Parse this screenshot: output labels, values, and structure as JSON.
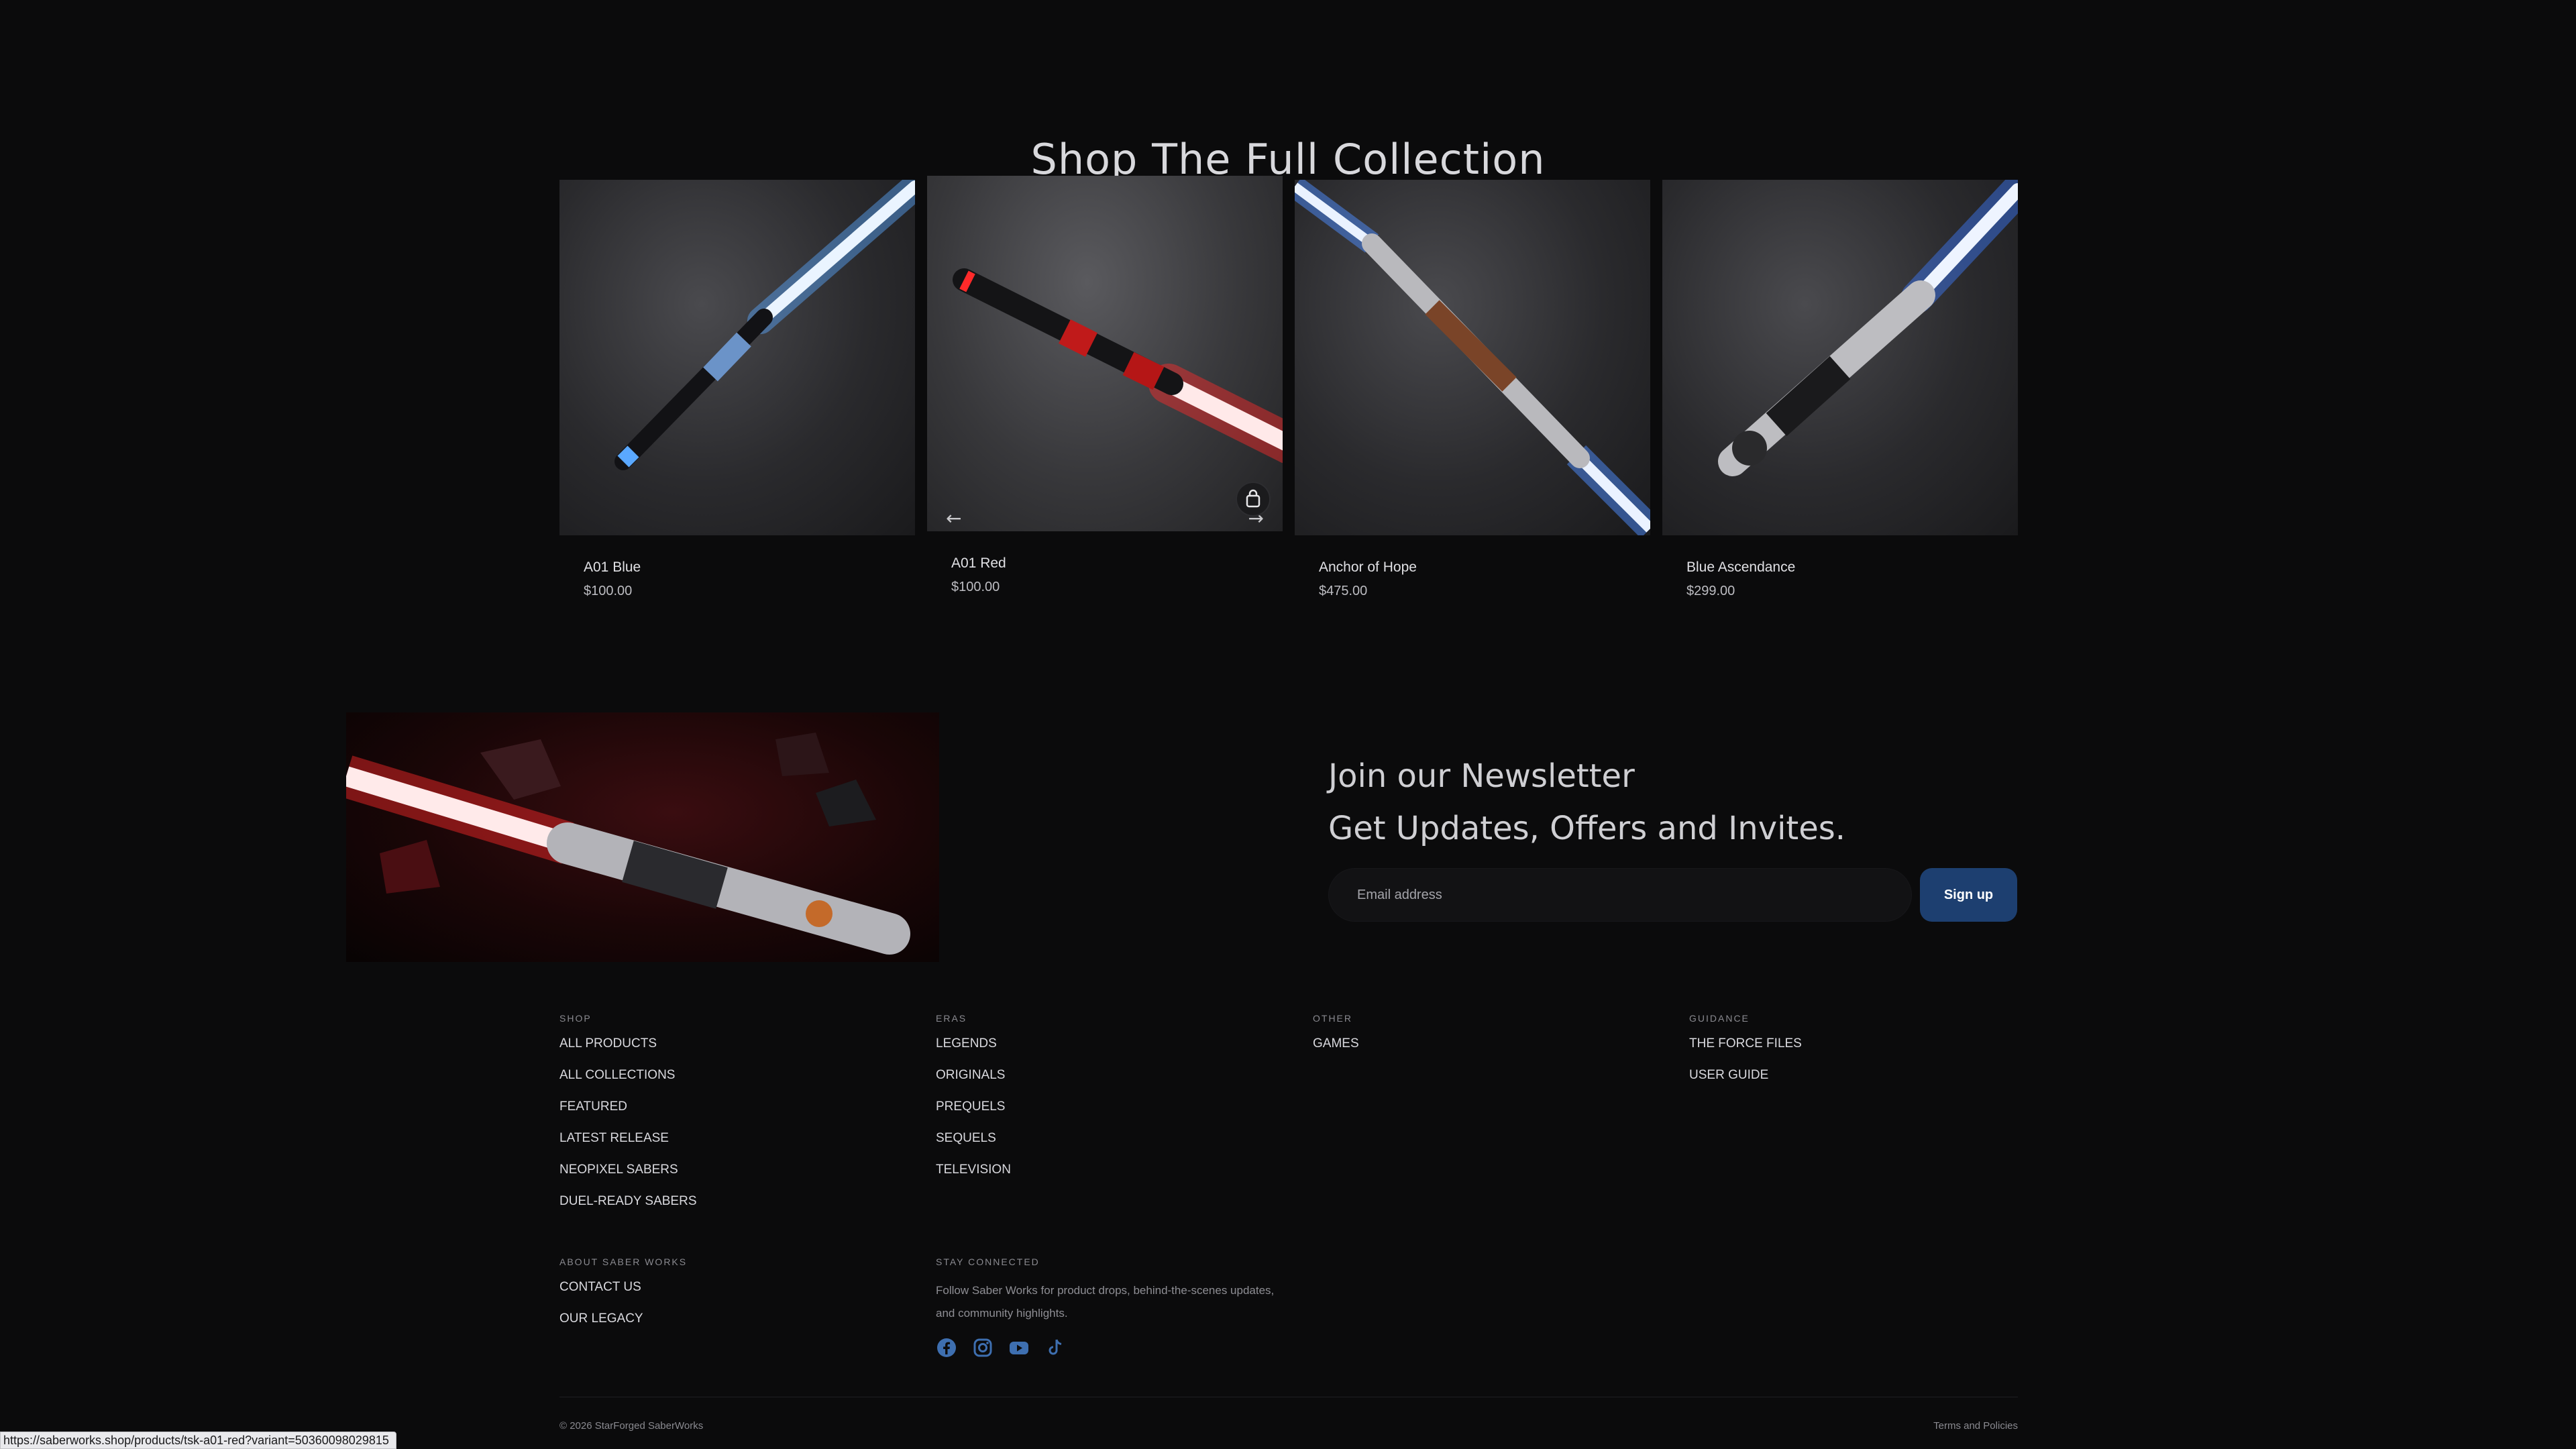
{
  "collection": {
    "title": "Shop The Full Collection",
    "products": [
      {
        "name": "A01 Blue",
        "price": "$100.00",
        "blade_color": "#5aa8ff"
      },
      {
        "name": "A01 Red",
        "price": "$100.00",
        "blade_color": "#ff2a2a"
      },
      {
        "name": "Anchor of Hope",
        "price": "$475.00",
        "blade_color": "#4d8dff"
      },
      {
        "name": "Blue Ascendance",
        "price": "$299.00",
        "blade_color": "#3d7bff"
      }
    ],
    "carousel_prev": "←",
    "carousel_next": "→"
  },
  "newsletter": {
    "line1": "Join our Newsletter",
    "line2": "Get Updates, Offers and Invites.",
    "email_placeholder": "Email address",
    "signup_label": "Sign up",
    "accent": "#1d3f70"
  },
  "footer": {
    "shop": {
      "heading": "SHOP",
      "items": [
        "ALL PRODUCTS",
        "ALL COLLECTIONS",
        "FEATURED",
        "LATEST RELEASE",
        "NEOPIXEL SABERS",
        "DUEL-READY SABERS"
      ]
    },
    "eras": {
      "heading": "ERAS",
      "items": [
        "LEGENDS",
        "ORIGINALS",
        "PREQUELS",
        "SEQUELS",
        "TELEVISION"
      ]
    },
    "other": {
      "heading": "OTHER",
      "items": [
        "GAMES"
      ]
    },
    "guidance": {
      "heading": "GUIDANCE",
      "items": [
        "THE FORCE FILES",
        "USER GUIDE"
      ]
    },
    "about": {
      "heading": "ABOUT SABER WORKS",
      "items": [
        "CONTACT US",
        "OUR LEGACY"
      ]
    },
    "stay_connected": {
      "heading": "STAY CONNECTED",
      "text": "Follow Saber Works for product drops, behind-the-scenes updates, and community highlights.",
      "icons": [
        "facebook-icon",
        "instagram-icon",
        "youtube-icon",
        "tiktok-icon"
      ],
      "icon_color": "#3e6fb0"
    },
    "copyright": "© 2026 StarForged SaberWorks",
    "terms": "Terms and Policies"
  },
  "status_bar": {
    "url": "https://saberworks.shop/products/tsk-a01-red?variant=50360098029815"
  }
}
